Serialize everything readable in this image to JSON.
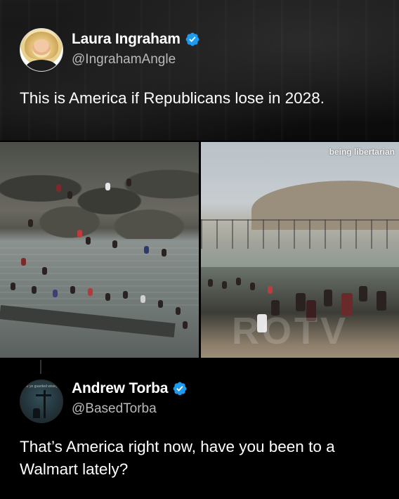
{
  "tweet1": {
    "name": "Laura Ingraham",
    "handle": "@IngrahamAngle",
    "text": "This is America if Republicans lose in 2028.",
    "images": {
      "right_watermark": "being libertarian",
      "ghost_watermark": "ROTV"
    }
  },
  "tweet2": {
    "name": "Andrew Torba",
    "handle": "@BasedTorba",
    "text": "That’s America right now, have you been to a Walmart lately?",
    "avatar_caption": "be ye guarded wisely"
  },
  "colors": {
    "verified_blue": "#1d9bf0",
    "background": "#000000",
    "handle_gray": "#b9b9b9"
  },
  "icons": {
    "verified": "verified-badge-icon"
  }
}
